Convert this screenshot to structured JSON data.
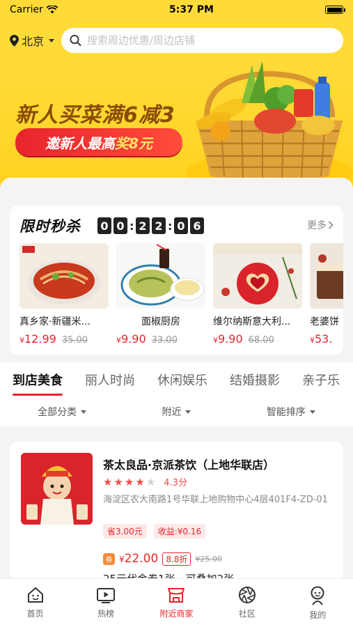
{
  "status": {
    "carrier": "Carrier",
    "time": "5:37 PM"
  },
  "header": {
    "city": "北京",
    "search_placeholder": "搜索周边优惠/周边店铺"
  },
  "banner": {
    "title": "新人买菜满6减3",
    "pill_prefix": "邀新人最高",
    "pill_highlight": "奖8元"
  },
  "flash_sale": {
    "title": "限时秒杀",
    "timer": [
      "0",
      "0",
      "2",
      "2",
      "0",
      "6"
    ],
    "more": "更多",
    "products": [
      {
        "name": "真乡家·新疆米...",
        "price_symbol": "¥",
        "price": "12.99",
        "orig": "35.00"
      },
      {
        "name": "面椒厨房",
        "price_symbol": "¥",
        "price": "9.90",
        "orig": "33.00"
      },
      {
        "name": "维尔纳斯意大利...",
        "price_symbol": "¥",
        "price": "9.90",
        "orig": "68.00"
      },
      {
        "name": "老婆饼",
        "price_symbol": "¥",
        "price": "53.",
        "orig": ""
      }
    ]
  },
  "tabs": [
    "到店美食",
    "丽人时尚",
    "休闲娱乐",
    "结婚摄影",
    "亲子乐"
  ],
  "filters": [
    "全部分类",
    "附近",
    "智能排序"
  ],
  "shop": {
    "name": "茶太良品·京派茶饮（上地华联店）",
    "rating_stars": 4,
    "score": "4.3分",
    "address": "海淀区农大南路1号华联上地购物中心4层401F4-ZD-01",
    "tags": [
      "省3.00元",
      "收益:¥0.16"
    ],
    "coupon_icon": "券",
    "deal_symbol": "¥",
    "deal_price": "22.00",
    "deal_discount": "8.8折",
    "deal_orig": "¥25.00",
    "deal_desc": "25元代金券1张，可叠加2张"
  },
  "bottom_nav": [
    {
      "label": "首页",
      "icon": "home-icon"
    },
    {
      "label": "热榜",
      "icon": "video-icon"
    },
    {
      "label": "附近商家",
      "icon": "shop-icon"
    },
    {
      "label": "社区",
      "icon": "aperture-icon"
    },
    {
      "label": "我的",
      "icon": "profile-icon"
    }
  ],
  "colors": {
    "brand_yellow": "#ffdb3a",
    "accent_red": "#e8242c"
  }
}
